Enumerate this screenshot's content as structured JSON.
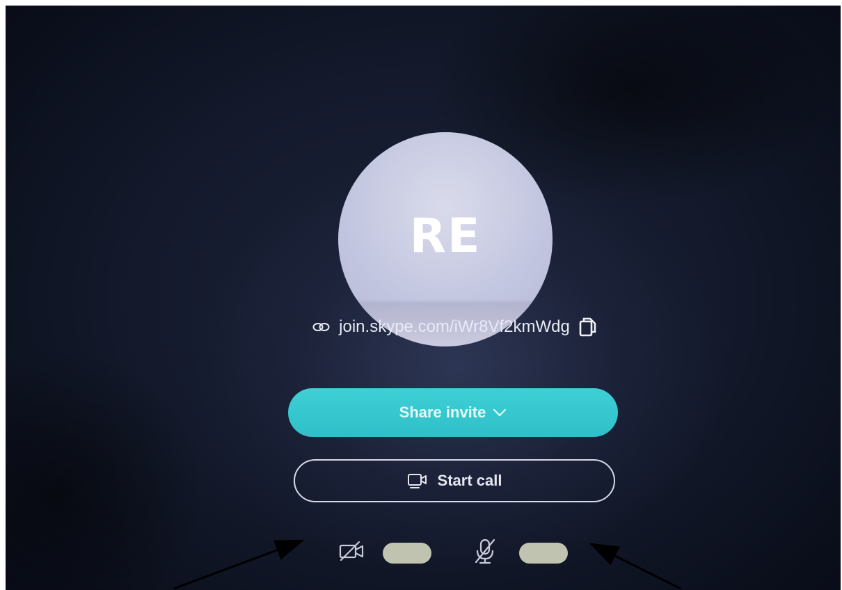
{
  "avatar": {
    "initials": "RE"
  },
  "invite_link": {
    "url": "join.skype.com/iWr8Vf2kmWdg",
    "link_icon": "link-icon",
    "copy_icon": "copy-icon"
  },
  "buttons": {
    "share_invite_label": "Share invite",
    "share_invite_icon": "chevron-down-icon",
    "start_call_label": "Start call",
    "start_call_icon": "video-call-icon"
  },
  "media_controls": {
    "camera": {
      "icon": "camera-off-icon",
      "enabled": false
    },
    "microphone": {
      "icon": "microphone-off-icon",
      "enabled": false
    }
  },
  "colors": {
    "accent": "#2fbfc8",
    "background": "#141a2c",
    "avatar": "#c3c6e0",
    "toggle": "#bfc3b0"
  }
}
